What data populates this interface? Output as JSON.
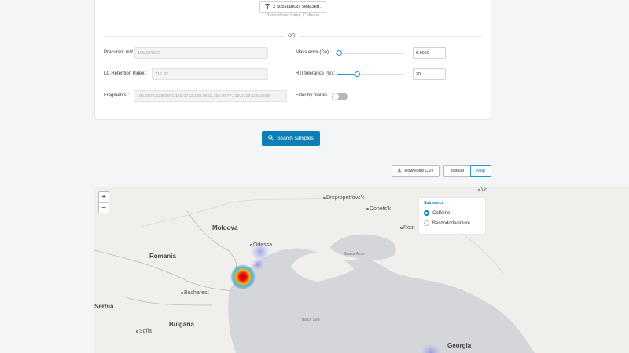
{
  "substances": {
    "button_label": "2 substances selected.",
    "selected_list": "Benzododecinium, Caffeine",
    "or_label": "OR"
  },
  "form": {
    "precursor_label": "Precursor m/z :",
    "precursor_value": "195.087652",
    "lc_label": "LC Retention Index :",
    "lc_value": "216.82",
    "fragments_label": "Fragments :",
    "fragments_value": "195.0876,138.0661,110.0712,138.0662,195.0877,110.0713,195.0878",
    "mass_error_label": "Mass error (Da) :",
    "mass_error_value": "0.0050",
    "mass_error_slider_fraction": 0.05,
    "rti_label": "RTI tolerance (%) :",
    "rti_value": "30",
    "rti_slider_fraction": 0.3,
    "blanks_label": "Filter by blanks :",
    "blanks_enabled": false
  },
  "actions": {
    "search_label": "Search samples",
    "download_label": "Download CSV",
    "tab_tabular": "Tabular",
    "tab_map": "Map",
    "active_tab": "Map"
  },
  "map": {
    "zoom_in": "+",
    "zoom_out": "−",
    "countries": {
      "moldova": "Moldova",
      "romania": "Romania",
      "bulgaria": "Bulgaria",
      "serbia": "Serbia",
      "georgia": "Georgia"
    },
    "cities": {
      "odessa": "Odessa",
      "bucharest": "Bucharest",
      "sofia": "Sofia",
      "dnipro": "Dnipropetrovs'k",
      "donetsk": "Donets'k",
      "rost": "Rost",
      "vo": "Vo"
    },
    "seas": {
      "azov": "Sea of Azov",
      "black": "Black Sea"
    },
    "legend": {
      "title": "Substance",
      "options": [
        "Caffeine",
        "Benzododecinium"
      ],
      "selected": "Caffeine"
    },
    "colors": {
      "water": "#d4d6da",
      "land": "#f1efec",
      "heat_hot": "#e8141c",
      "heat_cool": "#6d6ee8"
    }
  }
}
